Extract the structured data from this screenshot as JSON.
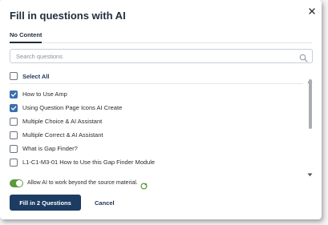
{
  "dialog": {
    "title": "Fill in questions with AI",
    "close_icon": "close-icon"
  },
  "tabs": [
    {
      "label": "No Content",
      "active": true
    }
  ],
  "search": {
    "placeholder": "Search questions",
    "value": "",
    "icon": "search-icon"
  },
  "select_all": {
    "label": "Select All",
    "checked": false
  },
  "questions": [
    {
      "label": "How to Use Amp",
      "checked": true
    },
    {
      "label": "Using Question Page Icons AI Create",
      "checked": true
    },
    {
      "label": "Multiple Choice & AI Assistant",
      "checked": false
    },
    {
      "label": "Multiple Correct & AI Assistant",
      "checked": false
    },
    {
      "label": "What is Gap Finder?",
      "checked": false
    },
    {
      "label": "L1-C1-M3-01 How to Use this Gap Finder Module",
      "checked": false
    }
  ],
  "ai_toggle": {
    "label": "Allow AI to work beyond the source material.",
    "on": true,
    "icon": "ai-sparkle-icon"
  },
  "actions": {
    "primary_label": "Fill in 2 Questions",
    "cancel_label": "Cancel"
  },
  "colors": {
    "primary": "#1d3c63",
    "checkbox_checked": "#3a6fb0",
    "toggle_on": "#5b9a3c"
  }
}
